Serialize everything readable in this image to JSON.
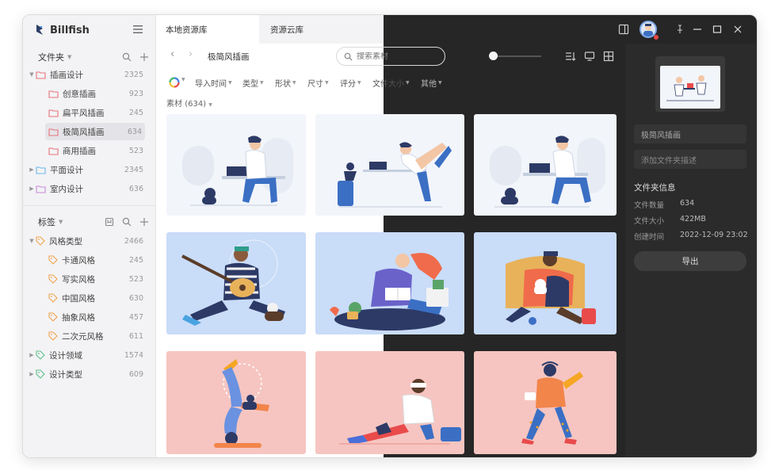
{
  "app": {
    "name": "Billfish"
  },
  "tabs": [
    {
      "label": "本地资源库",
      "active": true
    },
    {
      "label": "资源云库",
      "active": false
    }
  ],
  "folders": {
    "title": "文件夹",
    "items": [
      {
        "label": "插画设计",
        "count": "2325",
        "expanded": true
      },
      {
        "label": "创意插画",
        "count": "923"
      },
      {
        "label": "扁平风插画",
        "count": "245"
      },
      {
        "label": "极简风插画",
        "count": "634",
        "selected": true
      },
      {
        "label": "商用插画",
        "count": "523"
      },
      {
        "label": "平面设计",
        "count": "2345"
      },
      {
        "label": "室内设计",
        "count": "636"
      }
    ]
  },
  "tags": {
    "title": "标签",
    "items": [
      {
        "label": "风格类型",
        "count": "2466"
      },
      {
        "label": "卡通风格",
        "count": "245"
      },
      {
        "label": "写实风格",
        "count": "523"
      },
      {
        "label": "中国风格",
        "count": "630"
      },
      {
        "label": "抽象风格",
        "count": "457"
      },
      {
        "label": "二次元风格",
        "count": "611"
      },
      {
        "label": "设计领域",
        "count": "1574"
      },
      {
        "label": "设计类型",
        "count": "609"
      }
    ]
  },
  "toolbar": {
    "breadcrumb": "极简风插画",
    "search_placeholder": "搜索素材"
  },
  "filters": [
    "导入时间",
    "类型",
    "形状",
    "尺寸",
    "评分",
    "文件大小",
    "其他"
  ],
  "materials": {
    "label": "素材",
    "count": "(634)"
  },
  "panel": {
    "name_value": "极简风插画",
    "desc_placeholder": "添加文件夹描述",
    "info_title": "文件夹信息",
    "rows": [
      {
        "key": "文件数量",
        "value": "634"
      },
      {
        "key": "文件大小",
        "value": "422MB"
      },
      {
        "key": "创建时间",
        "value": "2022-12-09 23:02"
      }
    ],
    "export_label": "导出"
  },
  "colors": {
    "accent_folder": "#e9737a",
    "accent_folder_flat": "#6cb8e8",
    "accent_folder_interior": "#c78ad8",
    "tag_orange": "#f2a34a",
    "tag_green": "#5cc08a",
    "dark_bg": "#262626"
  }
}
